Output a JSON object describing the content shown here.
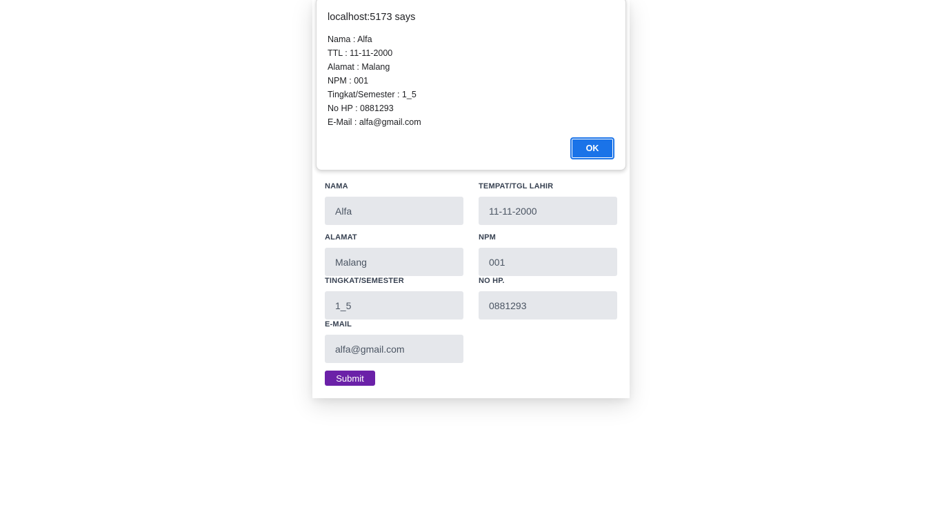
{
  "alert": {
    "title": "localhost:5173 says",
    "lines": [
      "Nama : Alfa",
      "TTL : 11-11-2000",
      "Alamat : Malang",
      "NPM : 001",
      "Tingkat/Semester : 1_5",
      "No HP : 0881293",
      "E-Mail : alfa@gmail.com"
    ],
    "ok_label": "OK",
    "accent_color": "#1a73e8"
  },
  "form": {
    "nama": {
      "label": "NAMA",
      "value": "Alfa"
    },
    "ttl": {
      "label": "TEMPAT/TGL LAHIR",
      "value": "11-11-2000"
    },
    "alamat": {
      "label": "ALAMAT",
      "value": "Malang"
    },
    "npm": {
      "label": "NPM",
      "value": "001"
    },
    "semester": {
      "label": "TINGKAT/SEMESTER",
      "value": "1_5"
    },
    "nohp": {
      "label": "NO HP.",
      "value": "0881293"
    },
    "email": {
      "label": "E-MAIL",
      "value": "alfa@gmail.com"
    },
    "submit_label": "Submit",
    "submit_color": "#6b21a8"
  }
}
